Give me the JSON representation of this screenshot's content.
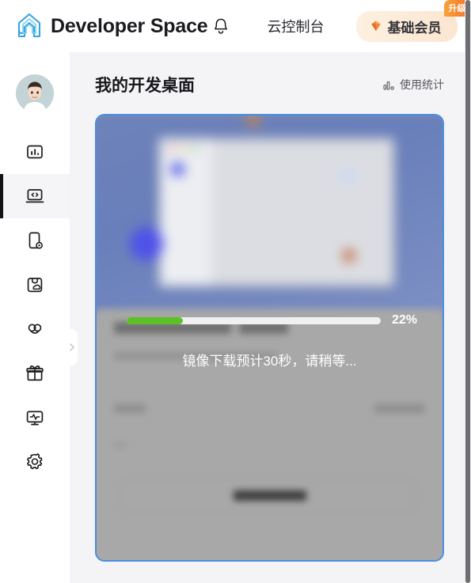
{
  "header": {
    "logo_icon": "house-logo-icon",
    "brand_name": "Developer Space",
    "bell_icon": "bell-icon",
    "nav_console": "云控制台",
    "member": {
      "diamond_icon": "diamond-icon",
      "label": "基础会员",
      "upgrade_tag": "升级",
      "background_color": "#fbe6d2",
      "upgrade_color": "#f2732a"
    }
  },
  "sidebar": {
    "avatar": "user-avatar",
    "collapse_icon": "chevron-right-icon",
    "items": [
      {
        "icon": "dashboard-chart-icon",
        "name": "dashboard",
        "active": false
      },
      {
        "icon": "laptop-code-icon",
        "name": "dev-desktop",
        "active": true
      },
      {
        "icon": "mobile-settings-icon",
        "name": "mobile-device",
        "active": false
      },
      {
        "icon": "bag-cloud-icon",
        "name": "app-store",
        "active": false
      },
      {
        "icon": "cloud-network-icon",
        "name": "cloud-network",
        "active": false
      },
      {
        "icon": "gift-icon",
        "name": "rewards",
        "active": false
      },
      {
        "icon": "monitor-pulse-icon",
        "name": "monitoring",
        "active": false
      },
      {
        "icon": "gear-icon",
        "name": "settings",
        "active": false
      }
    ],
    "active_indicator_color": "#131316"
  },
  "main": {
    "page_title": "我的开发桌面",
    "stats_link": {
      "icon": "bar-chart-icon",
      "label": "使用统计"
    },
    "card": {
      "border_color": "#4a8fe0",
      "thumbnail": "blurred-desktop-preview",
      "progress": {
        "percent": 22,
        "percent_label": "22%",
        "fill_color": "#5cc026",
        "track_color": "#f0f0f0"
      },
      "status_message": "镜像下载预计30秒，请稍等...",
      "blurred_content": true
    }
  },
  "scrollbar": {
    "thumb_color": "#6e6e73"
  }
}
